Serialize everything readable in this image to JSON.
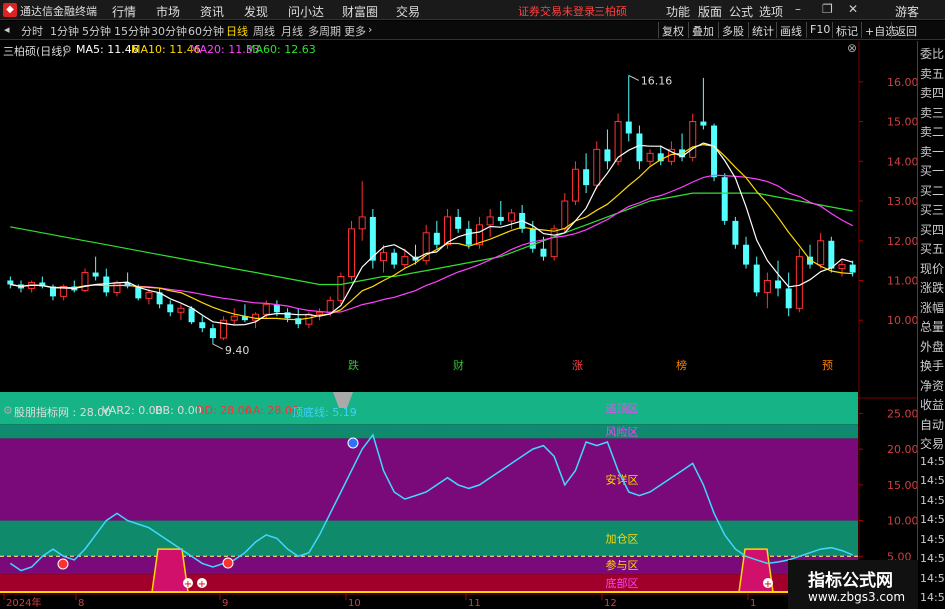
{
  "app": {
    "title": "通达信金融终端",
    "warning": "证券交易未登录",
    "stock_name_top": "三柏硕"
  },
  "menu": [
    "行情",
    "市场",
    "资讯",
    "发现",
    "问小达",
    "财富圈",
    "交易"
  ],
  "right_menu": [
    "功能",
    "版面",
    "公式",
    "选项",
    "游客"
  ],
  "periods": [
    "分时",
    "1分钟",
    "5分钟",
    "15分钟",
    "30分钟",
    "60分钟",
    "日线",
    "周线",
    "月线",
    "多周期",
    "更多"
  ],
  "active_period": "日线",
  "toolbar_buttons": [
    "复权",
    "叠加",
    "多股",
    "统计",
    "画线",
    "F10",
    "标记",
    "+自选",
    "返回"
  ],
  "price_info": {
    "stock": "三柏硕(日线)",
    "ma5": "MA5: 11.46",
    "ma10": "MA10: 11.46",
    "ma20": "MA20: 11.33",
    "ma60": "MA60: 12.63",
    "colors": {
      "ma5": "#ffffff",
      "ma10": "#ffd800",
      "ma20": "#ff40ff",
      "ma60": "#30e030"
    }
  },
  "price_axis": [
    "16.00",
    "15.00",
    "14.00",
    "13.00",
    "12.00",
    "11.00",
    "10.00"
  ],
  "price_marks": {
    "high": "16.16",
    "low": "9.40"
  },
  "event_tags": [
    "跌",
    "财",
    "涨",
    "榜",
    "预"
  ],
  "indicator_info": {
    "name": "股朋指标网 : 28.00",
    "var2": "VAR2: 0.00",
    "bb": "BB: 0.00",
    "dd": "DD: 28.00",
    "aa": "AA: 28.00",
    "dd_line": "顶底线: 5.19"
  },
  "indicator_axis": [
    "25.00",
    "20.00",
    "15.00",
    "10.00",
    "5.00"
  ],
  "zones": [
    "逃顶区",
    "风险区",
    "安详区",
    "加仓区",
    "参与区",
    "底部区"
  ],
  "time_axis": [
    "2024年",
    "8",
    "9",
    "10",
    "11",
    "12",
    "1"
  ],
  "quote_labels": [
    "委比",
    "卖五",
    "卖四",
    "卖三",
    "卖二",
    "卖一",
    "买一",
    "买二",
    "买三",
    "买四",
    "买五",
    "现价",
    "涨跌",
    "涨幅",
    "总量",
    "外盘",
    "换手",
    "净资",
    "收益",
    "自动",
    "交易",
    "14:56",
    "14:56",
    "14:56",
    "14:56",
    "14:56",
    "14:56",
    "14:56",
    "14:56"
  ],
  "watermark": {
    "line1": "指标公式网",
    "line2": "www.zbgs3.com"
  },
  "chart_data": {
    "type": "candlestick",
    "ylim": [
      9.2,
      16.6
    ],
    "candles": [
      [
        11.0,
        11.1,
        10.8,
        10.9
      ],
      [
        10.9,
        11.0,
        10.7,
        10.8
      ],
      [
        10.8,
        11.0,
        10.7,
        10.95
      ],
      [
        10.95,
        11.1,
        10.8,
        10.85
      ],
      [
        10.85,
        10.9,
        10.5,
        10.6
      ],
      [
        10.6,
        10.9,
        10.5,
        10.85
      ],
      [
        10.85,
        11.0,
        10.7,
        10.75
      ],
      [
        10.75,
        11.3,
        10.7,
        11.2
      ],
      [
        11.2,
        11.6,
        11.0,
        11.1
      ],
      [
        11.1,
        11.3,
        10.6,
        10.7
      ],
      [
        10.7,
        11.0,
        10.6,
        10.95
      ],
      [
        10.95,
        11.2,
        10.8,
        10.85
      ],
      [
        10.85,
        10.9,
        10.5,
        10.55
      ],
      [
        10.55,
        10.8,
        10.4,
        10.7
      ],
      [
        10.7,
        10.8,
        10.3,
        10.4
      ],
      [
        10.4,
        10.5,
        10.1,
        10.2
      ],
      [
        10.2,
        10.4,
        10.0,
        10.3
      ],
      [
        10.3,
        10.35,
        9.9,
        9.95
      ],
      [
        9.95,
        10.1,
        9.7,
        9.8
      ],
      [
        9.8,
        9.9,
        9.4,
        9.55
      ],
      [
        9.55,
        10.1,
        9.5,
        10.0
      ],
      [
        10.0,
        10.3,
        9.9,
        10.1
      ],
      [
        10.1,
        10.4,
        9.95,
        10.0
      ],
      [
        10.0,
        10.2,
        9.8,
        10.15
      ],
      [
        10.15,
        10.5,
        10.05,
        10.4
      ],
      [
        10.4,
        10.5,
        10.1,
        10.2
      ],
      [
        10.2,
        10.3,
        9.95,
        10.05
      ],
      [
        10.05,
        10.3,
        9.8,
        9.9
      ],
      [
        9.9,
        10.2,
        9.8,
        10.15
      ],
      [
        10.15,
        10.3,
        10.0,
        10.2
      ],
      [
        10.2,
        10.6,
        10.1,
        10.5
      ],
      [
        10.5,
        11.2,
        10.4,
        11.1
      ],
      [
        11.1,
        12.5,
        11.0,
        12.3
      ],
      [
        12.3,
        13.5,
        12.0,
        12.6
      ],
      [
        12.6,
        12.8,
        11.3,
        11.5
      ],
      [
        11.5,
        11.9,
        11.2,
        11.7
      ],
      [
        11.7,
        11.8,
        11.3,
        11.4
      ],
      [
        11.4,
        11.8,
        11.3,
        11.6
      ],
      [
        11.6,
        11.9,
        11.4,
        11.5
      ],
      [
        11.5,
        12.4,
        11.4,
        12.2
      ],
      [
        12.2,
        12.5,
        11.8,
        11.9
      ],
      [
        11.9,
        12.8,
        11.8,
        12.6
      ],
      [
        12.6,
        12.8,
        12.2,
        12.3
      ],
      [
        12.3,
        12.5,
        11.8,
        11.9
      ],
      [
        11.9,
        12.6,
        11.8,
        12.4
      ],
      [
        12.4,
        12.8,
        12.1,
        12.6
      ],
      [
        12.6,
        13.0,
        12.4,
        12.5
      ],
      [
        12.5,
        12.8,
        12.3,
        12.7
      ],
      [
        12.7,
        12.9,
        12.2,
        12.3
      ],
      [
        12.3,
        12.5,
        11.7,
        11.8
      ],
      [
        11.8,
        12.1,
        11.5,
        11.6
      ],
      [
        11.6,
        12.4,
        11.5,
        12.3
      ],
      [
        12.3,
        13.2,
        12.2,
        13.0
      ],
      [
        13.0,
        14.0,
        12.9,
        13.8
      ],
      [
        13.8,
        14.2,
        13.2,
        13.4
      ],
      [
        13.4,
        14.5,
        13.3,
        14.3
      ],
      [
        14.3,
        14.8,
        13.8,
        14.0
      ],
      [
        14.0,
        15.2,
        13.9,
        15.0
      ],
      [
        15.0,
        16.16,
        14.5,
        14.7
      ],
      [
        14.7,
        14.9,
        13.8,
        14.0
      ],
      [
        14.0,
        14.3,
        13.9,
        14.2
      ],
      [
        14.2,
        14.4,
        13.9,
        14.0
      ],
      [
        14.0,
        14.5,
        13.9,
        14.3
      ],
      [
        14.3,
        14.7,
        14.0,
        14.1
      ],
      [
        14.1,
        15.2,
        14.0,
        15.0
      ],
      [
        15.0,
        16.1,
        14.8,
        14.9
      ],
      [
        14.9,
        14.95,
        13.5,
        13.6
      ],
      [
        13.6,
        13.7,
        12.4,
        12.5
      ],
      [
        12.5,
        12.6,
        11.8,
        11.9
      ],
      [
        11.9,
        12.1,
        11.3,
        11.4
      ],
      [
        11.4,
        11.6,
        10.6,
        10.7
      ],
      [
        10.7,
        11.2,
        10.3,
        11.0
      ],
      [
        11.0,
        11.5,
        10.6,
        10.8
      ],
      [
        10.8,
        11.2,
        10.1,
        10.3
      ],
      [
        10.3,
        11.8,
        10.2,
        11.6
      ],
      [
        11.6,
        11.9,
        11.3,
        11.4
      ],
      [
        11.4,
        12.2,
        11.3,
        12.0
      ],
      [
        12.0,
        12.1,
        11.2,
        11.3
      ],
      [
        11.3,
        11.5,
        11.1,
        11.4
      ],
      [
        11.4,
        11.5,
        11.1,
        11.2
      ]
    ],
    "ma60": [
      12.35,
      12.3,
      12.25,
      12.2,
      12.15,
      12.1,
      12.05,
      12.0,
      11.95,
      11.9,
      11.85,
      11.8,
      11.75,
      11.7,
      11.65,
      11.6,
      11.55,
      11.5,
      11.45,
      11.4,
      11.35,
      11.3,
      11.25,
      11.2,
      11.15,
      11.1,
      11.05,
      11.0,
      10.95,
      10.9,
      10.9,
      10.9,
      10.95,
      11.0,
      11.05,
      11.1,
      11.1,
      11.15,
      11.2,
      11.25,
      11.3,
      11.35,
      11.4,
      11.45,
      11.5,
      11.55,
      11.6,
      11.7,
      11.8,
      11.9,
      12.0,
      12.1,
      12.2,
      12.3,
      12.4,
      12.5,
      12.6,
      12.7,
      12.8,
      12.9,
      13.0,
      13.05,
      13.1,
      13.15,
      13.2,
      13.2,
      13.2,
      13.2,
      13.2,
      13.2,
      13.2,
      13.15,
      13.1,
      13.05,
      13.0,
      12.95,
      12.9,
      12.85,
      12.8,
      12.75
    ],
    "indicator": {
      "ylim": [
        0,
        28
      ],
      "line": [
        4,
        3,
        3.5,
        5,
        6,
        5,
        4.5,
        6,
        8,
        10,
        11,
        10,
        9.5,
        9,
        8,
        7,
        6,
        5,
        4,
        3.5,
        4,
        4.5,
        5.5,
        7,
        8,
        7.5,
        6,
        5,
        5.5,
        8,
        11,
        14,
        17,
        20,
        22,
        17,
        14,
        13,
        13.5,
        14,
        15,
        16,
        15,
        14.5,
        15,
        16,
        17,
        18,
        19,
        20,
        20.5,
        19,
        15,
        17,
        21,
        20.5,
        21,
        17,
        14,
        13.5,
        14,
        15,
        16,
        17,
        18,
        15,
        11,
        8,
        6,
        5,
        4.5,
        4,
        4.2,
        4.5,
        5,
        5.5,
        6,
        6.2,
        5.8,
        5.2
      ],
      "dash_upper": 23,
      "dash_lower": 5
    }
  }
}
